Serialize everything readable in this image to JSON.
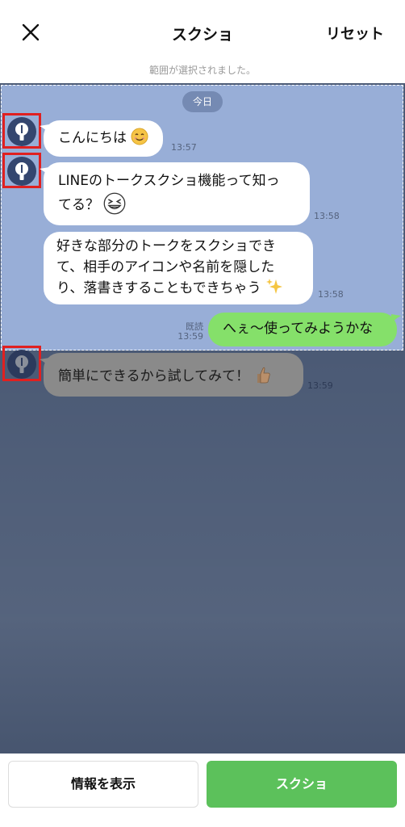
{
  "header": {
    "title": "スクショ",
    "reset_label": "リセット",
    "subtitle": "範囲が選択されました。"
  },
  "chat": {
    "date_label": "今日",
    "messages": [
      {
        "side": "left",
        "text": "こんにちは",
        "emoji": "smile-emoji",
        "time": "13:57",
        "selected": true
      },
      {
        "side": "left",
        "text_line1": "LINEのトークスクショ機能って知っ",
        "text_line2": "てる？",
        "emoji": "grin-squint-emoji",
        "time": "13:58",
        "selected": true
      },
      {
        "side": "left",
        "text_line1": "好きな部分のトークをスクショでき",
        "text_line2": "て、相手のアイコンや名前を隠した",
        "text_line3": "り、落書きすることもできちゃう",
        "emoji": "sparkles-emoji",
        "time": "13:58",
        "selected": true
      },
      {
        "side": "right",
        "text": "へぇ～使ってみようかな",
        "read_label": "既読",
        "time": "13:59",
        "selected": true
      },
      {
        "side": "left",
        "text": "簡単にできるから試してみて！",
        "emoji": "thumbs-up-emoji",
        "time": "13:59",
        "selected": false
      }
    ]
  },
  "footer": {
    "info_label": "情報を表示",
    "capture_label": "スクショ"
  },
  "colors": {
    "selection": "#98aed7",
    "chat_background": "#4b5a75",
    "outgoing_bubble": "#85e06a",
    "capture_button": "#5cc15b",
    "avatar_highlight": "#e02020"
  }
}
